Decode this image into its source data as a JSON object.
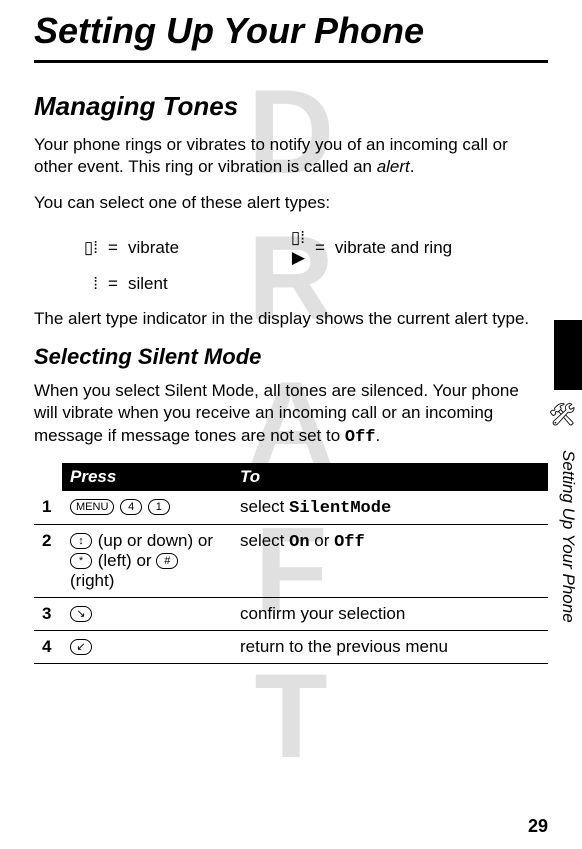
{
  "watermark": "DRAFT",
  "chapter_title": "Setting Up Your Phone",
  "section_title": "Managing Tones",
  "intro_p1": "Your phone rings or vibrates to notify you of an incoming call or other event. This ring or vibration is called an ",
  "intro_p1_em": "alert",
  "intro_p1_tail": ".",
  "intro_p2": "You can select one of these alert types:",
  "alerts": {
    "vibrate_icon": "▯⁞",
    "vibrate_label": "vibrate",
    "vibrate_ring_icon": "▯⁞▶",
    "vibrate_ring_label": "vibrate and ring",
    "silent_icon": "⁞",
    "silent_label": "silent",
    "eq": "="
  },
  "intro_p3": "The alert type indicator in the display shows the current alert type.",
  "subsection_title": "Selecting Silent Mode",
  "sub_p1_a": "When you select Silent Mode, all tones are silenced. Your phone will vibrate when you receive an incoming call or an incoming message if message tones are not set to ",
  "sub_p1_mono": "Off",
  "sub_p1_b": ".",
  "table": {
    "head_press": "Press",
    "head_to": "To",
    "rows": [
      {
        "num": "1",
        "press_keys": [
          "MENU",
          "4",
          "1"
        ],
        "to_a": "select ",
        "to_mono": "SilentMode",
        "to_b": ""
      },
      {
        "num": "2",
        "press_html": true,
        "press_key1": "↕",
        "press_txt1": " (up or down) or ",
        "press_key2": "*",
        "press_txt2": " (left) or ",
        "press_key3": "#",
        "press_txt3": " (right)",
        "to_a": "select ",
        "to_mono": "On",
        "to_mid": " or ",
        "to_mono2": "Off",
        "to_b": ""
      },
      {
        "num": "3",
        "press_keys": [
          "↘"
        ],
        "to_a": "confirm your selection",
        "to_mono": "",
        "to_b": ""
      },
      {
        "num": "4",
        "press_keys": [
          "↙"
        ],
        "to_a": "return to the previous menu",
        "to_mono": "",
        "to_b": ""
      }
    ]
  },
  "side_caption": "Setting Up Your Phone",
  "side_icon": "🛠",
  "page_number": "29"
}
